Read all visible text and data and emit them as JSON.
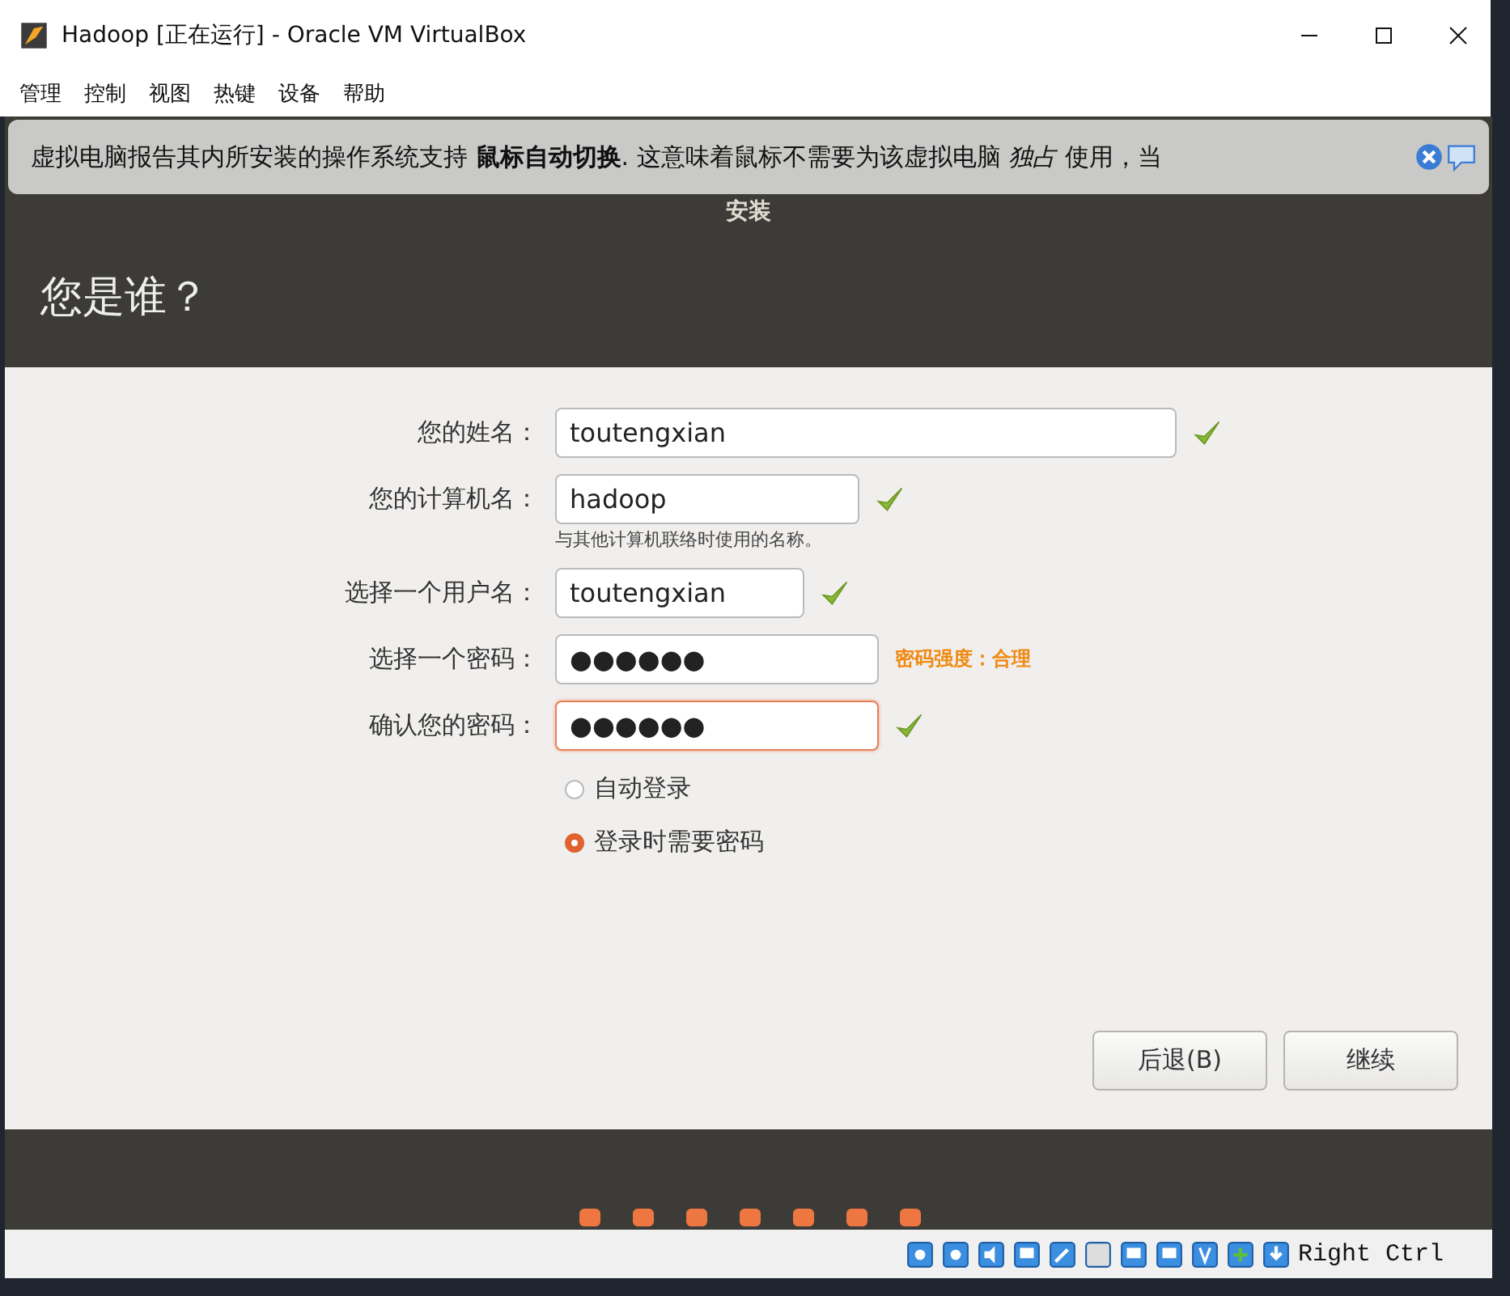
{
  "window": {
    "title": "Hadoop [正在运行] - Oracle VM VirtualBox"
  },
  "menu": [
    "管理",
    "控制",
    "视图",
    "热键",
    "设备",
    "帮助"
  ],
  "notification": {
    "text": "虚拟电脑报告其内所安装的操作系统支持 **鼠标自动切换**. 这意味着鼠标不需要为该虚拟电脑 *独占* 使用，当"
  },
  "installer": {
    "title": "安装",
    "heading": "您是谁？"
  },
  "fields": [
    {
      "label": "您的姓名：",
      "value": "toutengxian",
      "valid": true,
      "focused": false
    },
    {
      "label": "您的计算机名：",
      "value": "hadoop",
      "valid": true,
      "focused": false,
      "hint": "与其他计算机联络时使用的名称。"
    },
    {
      "label": "选择一个用户名：",
      "value": "toutengxian",
      "valid": true,
      "focused": false
    },
    {
      "label": "选择一个密码：",
      "value": "●●●●●●",
      "valid": false,
      "focused": false,
      "strength": "密码强度：合理"
    },
    {
      "label": "确认您的密码：",
      "value": "●●●●●●",
      "valid": true,
      "focused": true
    }
  ],
  "login_options": [
    {
      "label": "自动登录",
      "selected": false
    },
    {
      "label": "登录时需要密码",
      "selected": true
    }
  ],
  "buttons": [
    "后退(B)",
    "继续"
  ],
  "status_bar": {
    "host_key": "Right Ctrl"
  }
}
